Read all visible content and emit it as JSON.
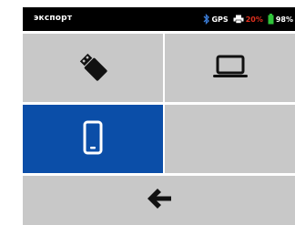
{
  "status_bar": {
    "title": "экспорт",
    "gps_label": "GPS",
    "printer_level": "20%",
    "battery_level": "98%",
    "colors": {
      "background": "#000000",
      "printer_level_text": "#e0301e",
      "battery_icon": "#2fc43a"
    },
    "icons": [
      "bluetooth-icon",
      "printer-icon",
      "battery-icon"
    ]
  },
  "tiles": [
    {
      "name": "usb",
      "icon": "usb-drive-icon",
      "selected": false
    },
    {
      "name": "laptop",
      "icon": "laptop-icon",
      "selected": false
    },
    {
      "name": "phone",
      "icon": "smartphone-icon",
      "selected": true
    },
    {
      "name": "empty",
      "icon": "",
      "selected": false
    },
    {
      "name": "back",
      "icon": "arrow-left-icon",
      "selected": false
    }
  ],
  "colors": {
    "tile_background": "#c8c8c8",
    "selected_background": "#0b4ea8",
    "icon_dark": "#111111",
    "icon_on_selected": "#ffffff"
  }
}
